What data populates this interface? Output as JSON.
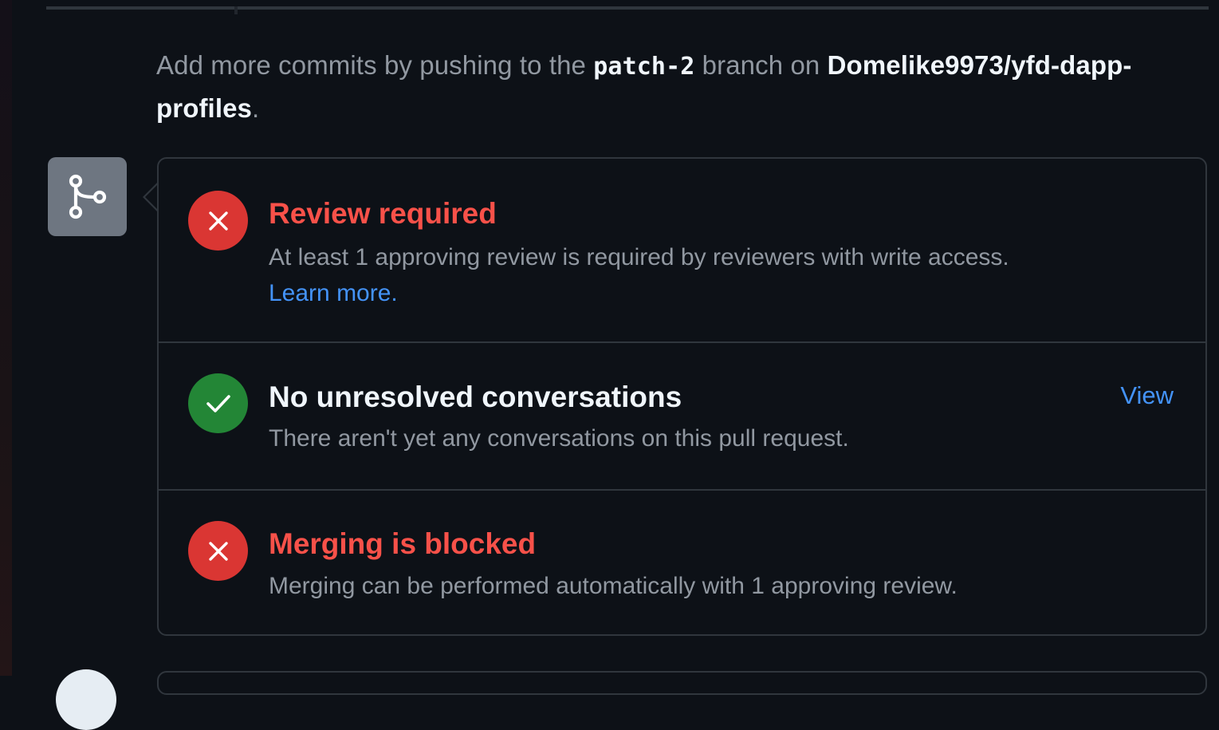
{
  "push_note": {
    "prefix": "Add more commits by pushing to the ",
    "branch": "patch-2",
    "middle": " branch on ",
    "repo": "Domelike9973/yfd-dapp-profiles",
    "suffix": "."
  },
  "merge_panel": {
    "badge_icon": "git-merge-icon",
    "checks": [
      {
        "status": "fail",
        "icon": "x-icon",
        "title": "Review required",
        "description": "At least 1 approving review is required by reviewers with write access.",
        "link": "Learn more."
      },
      {
        "status": "pass",
        "icon": "check-icon",
        "title": "No unresolved conversations",
        "description": "There aren't yet any conversations on this pull request.",
        "action": "View"
      },
      {
        "status": "fail",
        "icon": "x-icon",
        "title": "Merging is blocked",
        "description": "Merging can be performed automatically with 1 approving review."
      }
    ]
  },
  "colors": {
    "background": "#0d1117",
    "border": "#30363d",
    "danger": "#f85149",
    "danger_icon_bg": "#da3633",
    "success_icon_bg": "#238636",
    "link": "#4493f8",
    "muted_text": "#9198a1",
    "primary_text": "#f0f6fc"
  }
}
